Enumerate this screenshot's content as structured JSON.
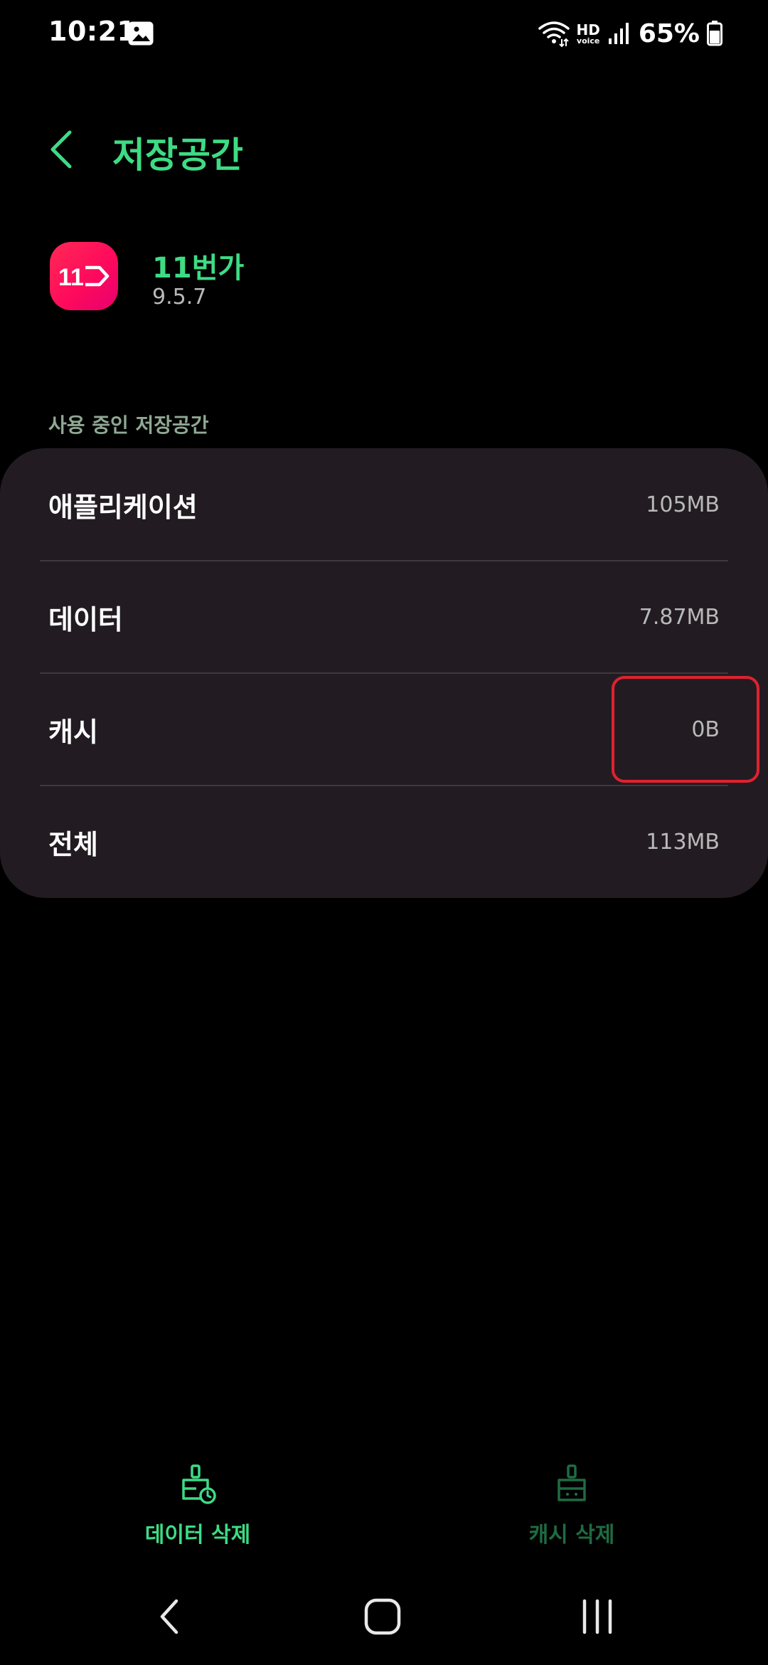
{
  "status_bar": {
    "time": "10:21",
    "hd_label": "HD",
    "voice_label": "voice",
    "battery": "65%"
  },
  "header": {
    "title": "저장공간"
  },
  "app": {
    "name": "11번가",
    "version": "9.5.7",
    "icon_text": "11"
  },
  "section": {
    "label": "사용 중인 저장공간"
  },
  "storage": {
    "rows": [
      {
        "label": "애플리케이션",
        "value": "105MB"
      },
      {
        "label": "데이터",
        "value": "7.87MB"
      },
      {
        "label": "캐시",
        "value": "0B"
      },
      {
        "label": "전체",
        "value": "113MB"
      }
    ]
  },
  "actions": {
    "clear_data": "데이터 삭제",
    "clear_cache": "캐시 삭제"
  },
  "colors": {
    "accent": "#3ddc84",
    "accent_disabled": "#1f6b42",
    "card": "#221c22",
    "highlight": "#e0222f"
  },
  "icons": {
    "back": "chevron-left-icon",
    "clear_data": "broom-icon",
    "clear_cache": "broom-icon",
    "nav_back": "nav-back-icon",
    "nav_home": "nav-home-icon",
    "nav_recent": "nav-recent-icon"
  }
}
